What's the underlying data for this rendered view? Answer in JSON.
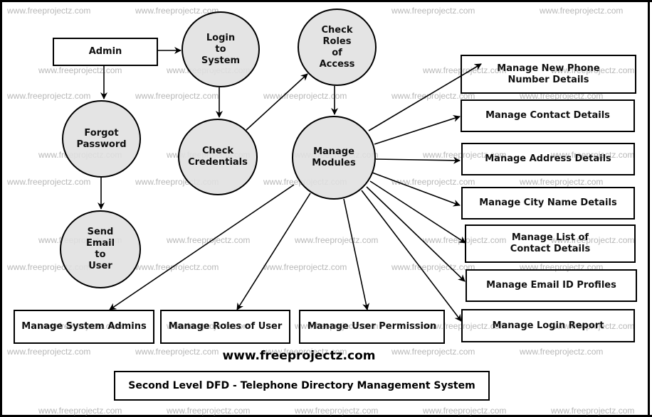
{
  "diagram": {
    "title": "Second Level DFD - Telephone Directory Management System",
    "website": "www.freeprojectz.com",
    "watermark": "www.freeprojectz.com",
    "colors": {
      "process_fill": "#e0e0e0",
      "stroke": "#000000",
      "watermark": "#b8b8b8"
    },
    "entities": {
      "admin": "Admin",
      "phone": "Manage New Phone\nNumber Details",
      "contact": "Manage Contact Details",
      "address": "Manage Address Details",
      "city": "Manage City Name Details",
      "list": "Manage List of\nContact Details",
      "email": "Manage Email ID Profiles",
      "login_report": "Manage Login  Report",
      "sys_admins": "Manage System Admins",
      "roles_user": "Manage Roles of User",
      "user_perm": "Manage User Permission"
    },
    "processes": {
      "login": "Login\nto\nSystem",
      "check_roles": "Check\nRoles\nof\nAccess",
      "forgot": "Forgot\nPassword",
      "check_cred": "Check\nCredentials",
      "manage_modules": "Manage\nModules",
      "send_email": "Send\nEmail\nto\nUser"
    },
    "flows": [
      {
        "from": "Admin",
        "to": "Login to System"
      },
      {
        "from": "Admin",
        "to": "Forgot Password"
      },
      {
        "from": "Forgot Password",
        "to": "Send Email to User"
      },
      {
        "from": "Login to System",
        "to": "Check Credentials"
      },
      {
        "from": "Check Credentials",
        "to": "Check Roles of Access"
      },
      {
        "from": "Check Roles of Access",
        "to": "Manage Modules"
      },
      {
        "from": "Manage Modules",
        "to": "Manage New Phone Number Details"
      },
      {
        "from": "Manage Modules",
        "to": "Manage Contact Details"
      },
      {
        "from": "Manage Modules",
        "to": "Manage Address Details"
      },
      {
        "from": "Manage Modules",
        "to": "Manage City Name Details"
      },
      {
        "from": "Manage Modules",
        "to": "Manage List of Contact Details"
      },
      {
        "from": "Manage Modules",
        "to": "Manage Email ID Profiles"
      },
      {
        "from": "Manage Modules",
        "to": "Manage Login Report"
      },
      {
        "from": "Manage Modules",
        "to": "Manage System Admins"
      },
      {
        "from": "Manage Modules",
        "to": "Manage Roles of User"
      },
      {
        "from": "Manage Modules",
        "to": "Manage User Permission"
      }
    ]
  }
}
